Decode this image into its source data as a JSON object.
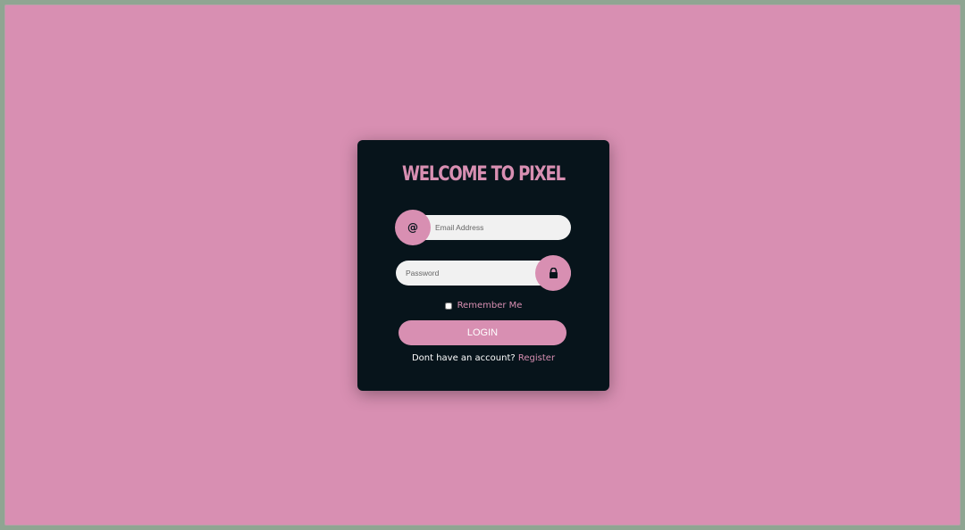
{
  "login": {
    "title": "WELCOME TO PIXEL",
    "email_placeholder": "Email Address",
    "email_value": "",
    "password_placeholder": "Password",
    "password_value": "",
    "email_icon": "at-icon",
    "password_icon": "lock-icon",
    "remember_label": "Remember Me",
    "remember_checked": false,
    "login_label": "LOGIN",
    "register_prompt": "Dont have an account?",
    "register_link": "Register"
  },
  "colors": {
    "background": "#d88fb2",
    "card": "#07141b",
    "accent": "#d88fb2",
    "field": "#f1f1f1",
    "window_frame": "#8fa592"
  }
}
